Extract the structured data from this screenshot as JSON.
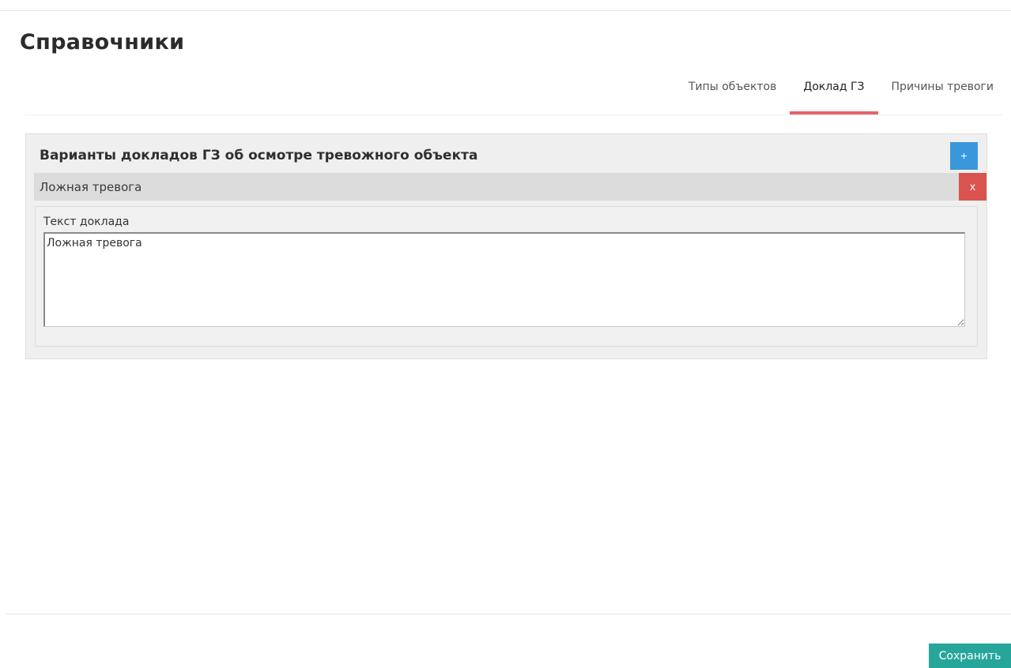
{
  "page": {
    "title": "Справочники"
  },
  "tabs": [
    {
      "label": "Типы объектов",
      "active": false
    },
    {
      "label": "Доклад ГЗ",
      "active": true
    },
    {
      "label": "Причины тревоги",
      "active": false
    }
  ],
  "panel": {
    "title": "Варианты докладов ГЗ об осмотре тревожного объекта",
    "add_label": "+",
    "items": [
      {
        "title": "Ложная тревога",
        "delete_label": "x",
        "field_label": "Текст доклада",
        "field_value": "Ложная тревога"
      }
    ]
  },
  "footer": {
    "save_label": "Сохранить"
  },
  "colors": {
    "active_tab_underline": "#e8616a",
    "add_button": "#3a97dc",
    "delete_button": "#d9534f",
    "save_button": "#26a69a"
  }
}
